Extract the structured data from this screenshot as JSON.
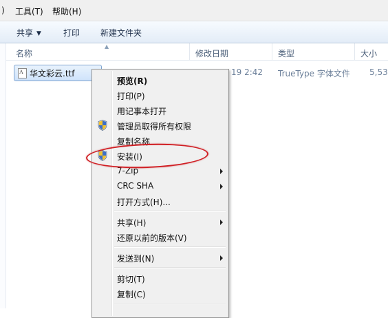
{
  "menubar": {
    "items": [
      {
        "label": ")"
      },
      {
        "label": "工具(T)"
      },
      {
        "label": "帮助(H)"
      }
    ]
  },
  "toolbar": {
    "share_label": "共享",
    "print_label": "打印",
    "new_folder_label": "新建文件夹"
  },
  "columns": {
    "name": "名称",
    "modified": "修改日期",
    "type": "类型",
    "size": "大小"
  },
  "file": {
    "name": "华文彩云.ttf",
    "modified": "19 2:42",
    "type": "TrueType 字体文件",
    "size": "5,53"
  },
  "context_menu": {
    "items": [
      {
        "label": "预览(R)",
        "bold": true
      },
      {
        "label": "打印(P)"
      },
      {
        "label": "用记事本打开"
      },
      {
        "label": "管理员取得所有权限",
        "icon": "uac-shield-icon"
      },
      {
        "label": "复制名称"
      },
      {
        "label": "安装(I)",
        "icon": "uac-shield-icon",
        "highlighted": true
      },
      {
        "label": "7-Zip",
        "submenu": true
      },
      {
        "label": "CRC SHA",
        "submenu": true
      },
      {
        "label": "打开方式(H)..."
      },
      {
        "label": "共享(H)",
        "submenu": true
      },
      {
        "label": "还原以前的版本(V)"
      },
      {
        "label": "发送到(N)",
        "submenu": true
      },
      {
        "label": "剪切(T)"
      },
      {
        "label": "复制(C)"
      }
    ]
  },
  "colors": {
    "highlight_ring": "#d01f24",
    "selection_fill": "#cfe3fb",
    "selection_border": "#7da2ce",
    "menu_background": "#f0f0f0"
  }
}
